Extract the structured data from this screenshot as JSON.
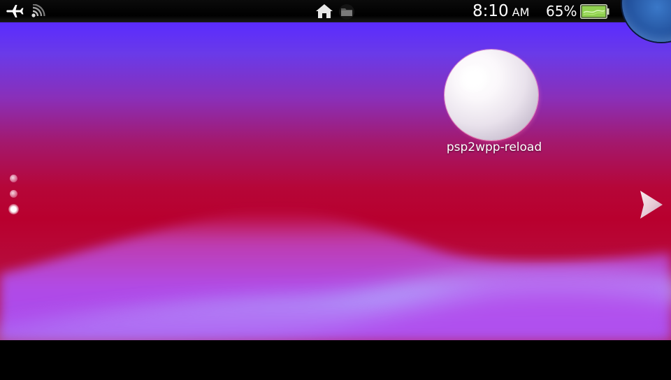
{
  "status_bar": {
    "icons": {
      "airplane": "airplane-mode-icon",
      "wifi": "wifi-signal-icon",
      "home": "home-icon",
      "folder": "content-manager-icon"
    },
    "time": "8:10",
    "ampm": "AM",
    "battery_percent": "65%",
    "battery_level": 0.65,
    "battery_color": "#8fd14f"
  },
  "home_screen": {
    "app": {
      "label": "psp2wpp-reload",
      "icon": "app-bubble-icon"
    },
    "pages": {
      "count": 3,
      "current": 3
    },
    "next_page_icon": "arrow-right-icon"
  },
  "colors": {
    "wallpaper_top": "#5a2bff",
    "wallpaper_mid": "#b8002e",
    "wave_highlight": "#a8b8ff",
    "wave_purple": "#b44cf0"
  }
}
